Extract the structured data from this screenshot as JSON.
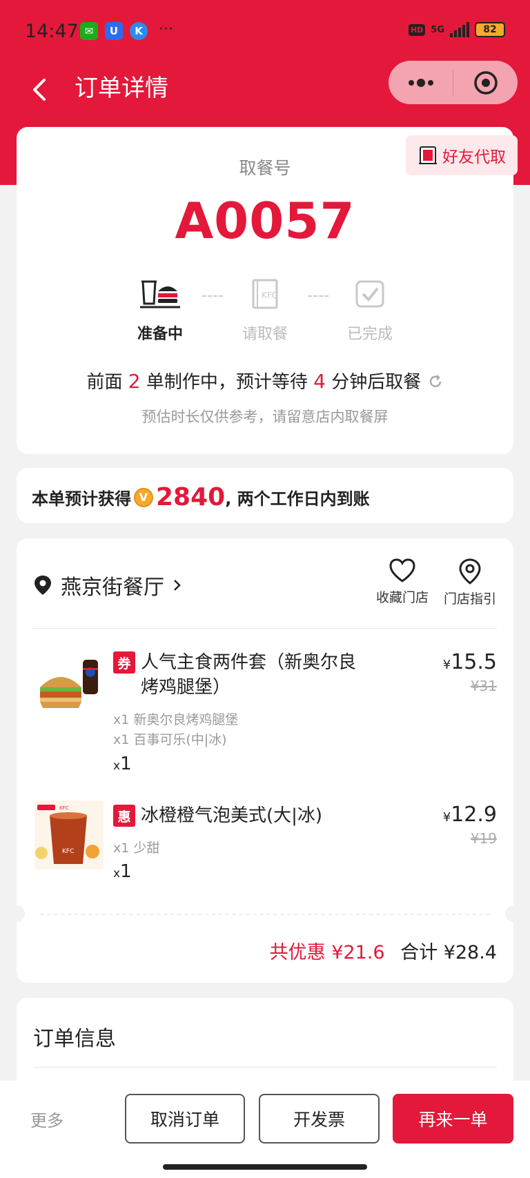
{
  "status": {
    "time": "14:47",
    "network": "5G",
    "battery": "82"
  },
  "nav": {
    "title": "订单详情"
  },
  "pickup": {
    "friend_label": "好友代取",
    "label": "取餐号",
    "number": "A0057",
    "steps": [
      "准备中",
      "请取餐",
      "已完成"
    ],
    "wait_prefix": "前面",
    "wait_count": "2",
    "wait_middle": "单制作中，预计等待",
    "wait_minutes": "4",
    "wait_suffix": "分钟后取餐",
    "note": "预估时长仅供参考，请留意店内取餐屏"
  },
  "points": {
    "prefix": "本单预计获得",
    "value": "2840",
    "suffix": ", 两个工作日内到账"
  },
  "store": {
    "name": "燕京街餐厅",
    "fav_label": "收藏门店",
    "guide_label": "门店指引"
  },
  "items": [
    {
      "tag": "券",
      "name_line1": "人气主食两件套（新奥尔良",
      "name_line2": "烤鸡腿堡）",
      "details": [
        "x1 新奥尔良烤鸡腿堡",
        "x1 百事可乐(中|冰)"
      ],
      "qty": "1",
      "price": "15.5",
      "original": "¥31"
    },
    {
      "tag": "惠",
      "name_line1": "冰橙橙气泡美式(大|冰)",
      "details": [
        "x1 少甜"
      ],
      "qty": "1",
      "price": "12.9",
      "original": "¥19"
    }
  ],
  "currency": "¥",
  "qty_prefix": "x",
  "summary": {
    "discount_label": "共优惠 ¥21.6",
    "total_label": "合计 ¥28.4"
  },
  "order_info": {
    "title": "订单信息"
  },
  "actions": {
    "more": "更多",
    "cancel": "取消订单",
    "invoice": "开发票",
    "reorder": "再来一单"
  },
  "colors": {
    "brand": "#e4183a"
  }
}
